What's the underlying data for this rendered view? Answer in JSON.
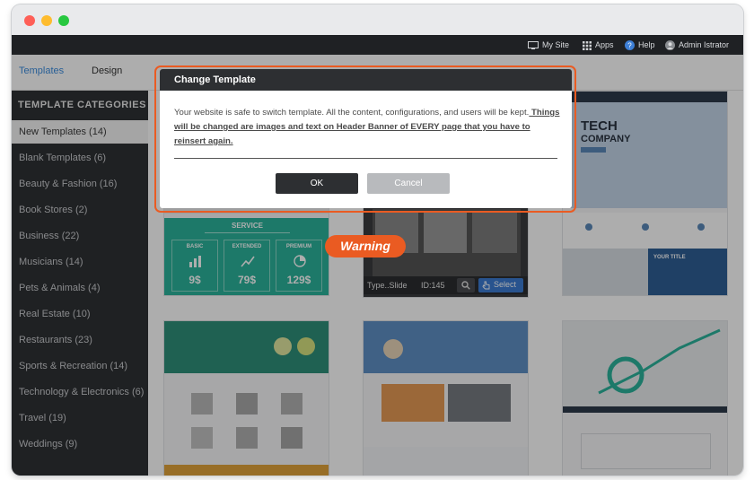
{
  "window": {
    "controls": [
      "close",
      "minimize",
      "maximize"
    ],
    "colors": {
      "close": "#fe5f57",
      "minimize": "#febc2e",
      "maximize": "#28c840"
    }
  },
  "topnav": {
    "items": [
      {
        "label": "My Site",
        "icon": "monitor-icon"
      },
      {
        "label": "Apps",
        "icon": "grid-icon"
      },
      {
        "label": "Help",
        "icon": "question-icon"
      },
      {
        "label": "Admin Istrator",
        "icon": "user-avatar-icon"
      }
    ]
  },
  "subnav": {
    "tabs": [
      {
        "label": "Templates",
        "active": true
      },
      {
        "label": "Design",
        "active": false
      }
    ]
  },
  "sidebar": {
    "title": "TEMPLATE CATEGORIES",
    "items": [
      {
        "label": "New Templates (14)",
        "active": true
      },
      {
        "label": "Blank Templates (6)"
      },
      {
        "label": "Beauty & Fashion (16)"
      },
      {
        "label": "Book Stores (2)"
      },
      {
        "label": "Business (22)"
      },
      {
        "label": "Musicians (14)"
      },
      {
        "label": "Pets & Animals (4)"
      },
      {
        "label": "Real Estate (10)"
      },
      {
        "label": "Restaurants (23)"
      },
      {
        "label": "Sports & Recreation (14)"
      },
      {
        "label": "Technology & Electronics (6)"
      },
      {
        "label": "Travel (19)"
      },
      {
        "label": "Weddings (9)"
      }
    ]
  },
  "templates": {
    "card1": {
      "section_label": "SERVICE",
      "plans": [
        {
          "name": "BASIC",
          "price": "9$"
        },
        {
          "name": "EXTENDED",
          "price": "79$"
        },
        {
          "name": "PREMIUM",
          "price": "129$"
        }
      ]
    },
    "card2": {
      "type_label": "Type..Slide",
      "id_label": "ID:145",
      "select_label": "Select"
    },
    "card3": {
      "headline_1": "TECH",
      "headline_2": "COMPANY",
      "section_label": "YOUR TITLE"
    }
  },
  "dialog": {
    "title": "Change Template",
    "body_1": "Your website is safe to switch template. All the content, configurations, and users will be kept.",
    "body_2": " Things will be changed are images and text on Header Banner of EVERY page that you have to reinsert again.",
    "ok_label": "OK",
    "cancel_label": "Cancel"
  },
  "callout": {
    "label": "Warning",
    "color": "#ea5b22"
  },
  "colors": {
    "accent": "#ea5b22",
    "dark": "#2d2f32",
    "sidebar": "#2f3134",
    "teal": "#2bb39b"
  }
}
